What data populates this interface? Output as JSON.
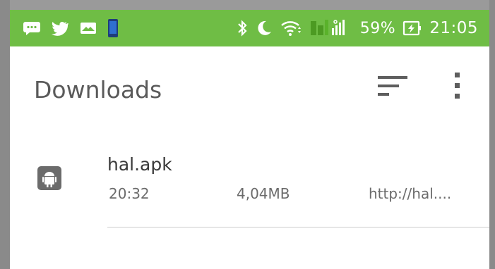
{
  "statusbar": {
    "battery_percent": "59%",
    "clock": "21:05",
    "background": "#6fbd45",
    "left_icons": [
      "message-icon",
      "twitter-icon",
      "mail-icon",
      "phone-icon"
    ],
    "right_icons": [
      "bluetooth-icon",
      "moon-icon",
      "wifi-icon",
      "signal-icon",
      "battery-charging-icon"
    ]
  },
  "toolbar": {
    "title": "Downloads",
    "sort_icon": "sort-icon",
    "menu_icon": "more-vert-icon"
  },
  "downloads": [
    {
      "icon": "android-icon",
      "name": "hal.apk",
      "time": "20:32",
      "size": "4,04MB",
      "source": "http://hal...."
    }
  ]
}
